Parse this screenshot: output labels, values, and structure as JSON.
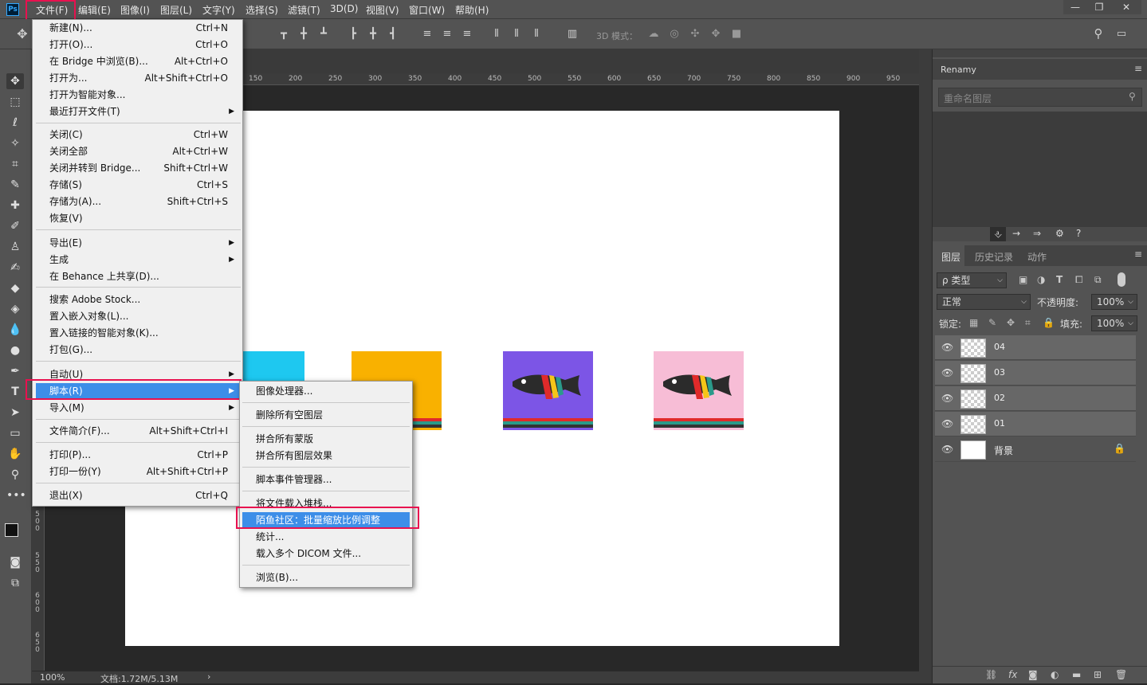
{
  "menubar": {
    "logo": "Ps",
    "items": [
      "文件(F)",
      "编辑(E)",
      "图像(I)",
      "图层(L)",
      "文字(Y)",
      "选择(S)",
      "滤镜(T)",
      "3D(D)",
      "视图(V)",
      "窗口(W)",
      "帮助(H)"
    ],
    "window_buttons": [
      "—",
      "❐",
      "✕"
    ]
  },
  "optionsbar": {
    "mode_label": "3D 模式："
  },
  "ruler": {
    "top": [
      "150",
      "200",
      "250",
      "300",
      "350",
      "400",
      "450",
      "500",
      "550",
      "600",
      "650",
      "700",
      "750",
      "800",
      "850",
      "900",
      "950"
    ],
    "left": [
      "5\n0\n0",
      "5\n5\n0",
      "6\n0\n0",
      "6\n5\n0"
    ]
  },
  "file_menu": {
    "items": [
      {
        "label": "新建(N)...",
        "shortcut": "Ctrl+N"
      },
      {
        "label": "打开(O)...",
        "shortcut": "Ctrl+O"
      },
      {
        "label": "在 Bridge 中浏览(B)...",
        "shortcut": "Alt+Ctrl+O"
      },
      {
        "label": "打开为...",
        "shortcut": "Alt+Shift+Ctrl+O"
      },
      {
        "label": "打开为智能对象...",
        "shortcut": ""
      },
      {
        "label": "最近打开文件(T)",
        "shortcut": ""
      },
      {
        "label": "关闭(C)",
        "shortcut": "Ctrl+W"
      },
      {
        "label": "关闭全部",
        "shortcut": "Alt+Ctrl+W"
      },
      {
        "label": "关闭并转到 Bridge...",
        "shortcut": "Shift+Ctrl+W"
      },
      {
        "label": "存储(S)",
        "shortcut": "Ctrl+S"
      },
      {
        "label": "存储为(A)...",
        "shortcut": "Shift+Ctrl+S"
      },
      {
        "label": "恢复(V)",
        "shortcut": ""
      },
      {
        "label": "导出(E)",
        "shortcut": ""
      },
      {
        "label": "生成",
        "shortcut": ""
      },
      {
        "label": "在 Behance 上共享(D)...",
        "shortcut": ""
      },
      {
        "label": "搜索 Adobe Stock...",
        "shortcut": ""
      },
      {
        "label": "置入嵌入对象(L)...",
        "shortcut": ""
      },
      {
        "label": "置入链接的智能对象(K)...",
        "shortcut": ""
      },
      {
        "label": "打包(G)...",
        "shortcut": ""
      },
      {
        "label": "自动(U)",
        "shortcut": ""
      },
      {
        "label": "脚本(R)",
        "shortcut": ""
      },
      {
        "label": "导入(M)",
        "shortcut": ""
      },
      {
        "label": "文件简介(F)...",
        "shortcut": "Alt+Shift+Ctrl+I"
      },
      {
        "label": "打印(P)...",
        "shortcut": "Ctrl+P"
      },
      {
        "label": "打印一份(Y)",
        "shortcut": "Alt+Shift+Ctrl+P"
      },
      {
        "label": "退出(X)",
        "shortcut": "Ctrl+Q"
      }
    ]
  },
  "script_submenu": {
    "items": [
      "图像处理器...",
      "删除所有空图层",
      "拼合所有蒙版",
      "拼合所有图层效果",
      "脚本事件管理器...",
      "将文件载入堆栈...",
      "陌鱼社区：批量缩放比例调整",
      "统计...",
      "载入多个 DICOM 文件...",
      "浏览(B)..."
    ]
  },
  "statusbar": {
    "zoom": "100%",
    "doc": "文档:1.72M/5.13M"
  },
  "renamy": {
    "title": "Renamy",
    "search_placeholder": "重命名图层"
  },
  "layers_panel": {
    "tabs": [
      "图层",
      "历史记录",
      "动作"
    ],
    "filter": "ρ 类型",
    "blend": "正常",
    "opacity_label": "不透明度:",
    "opacity": "100%",
    "lock_label": "锁定:",
    "fill_label": "填充:",
    "fill": "100%",
    "layers": [
      "04",
      "03",
      "02",
      "01",
      "背景"
    ]
  },
  "colors": {
    "highlight": "#3d8ee8",
    "annotation": "#e8114f",
    "thumb_blue": "#1ec8f0",
    "thumb_yellow": "#f9b100",
    "thumb_purple": "#7c55e6",
    "thumb_pink": "#f7bdd6"
  }
}
